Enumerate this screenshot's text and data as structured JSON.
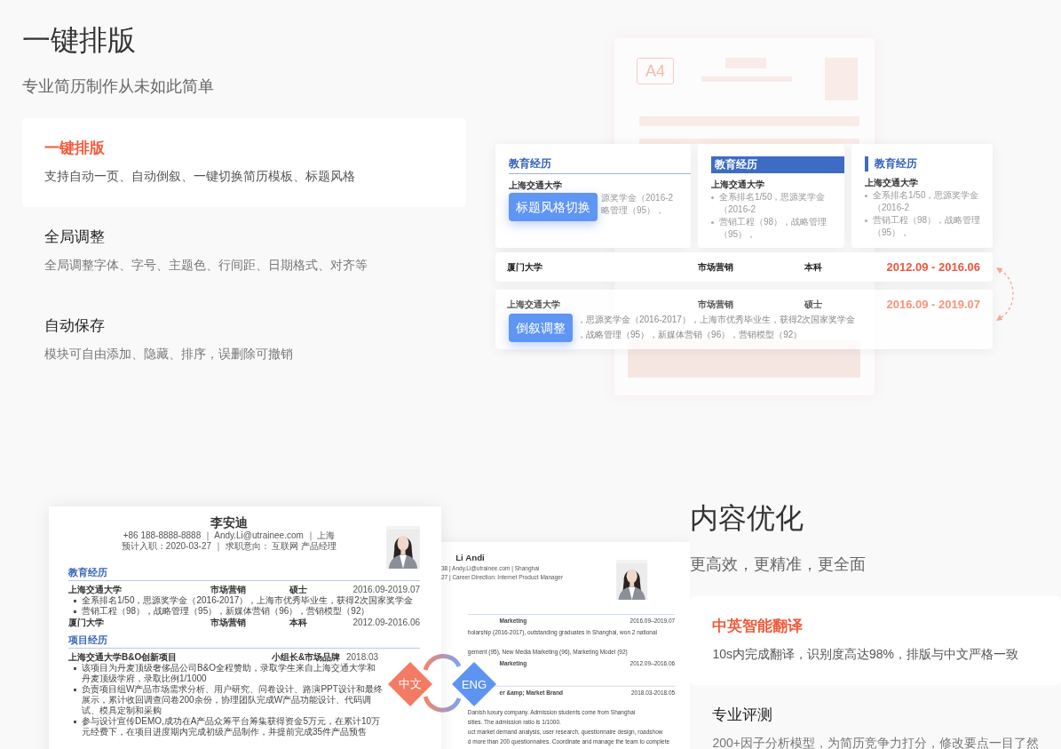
{
  "layout_section": {
    "title": "一键排版",
    "subtitle": "专业简历制作从未如此简单",
    "features": [
      {
        "title": "一键排版",
        "description": "支持自动一页、自动倒叙、一键切换简历模板、标题风格",
        "selected": true
      },
      {
        "title": "全局调整",
        "description": "全局调整字体、字号、主题色、行间距、日期格式、对齐等",
        "selected": false
      },
      {
        "title": "自动保存",
        "description": "模块可自由添加、隐藏、排序，误删除可撤销",
        "selected": false
      }
    ]
  },
  "layout_illustration": {
    "paper_label": "A4",
    "heading_styles": [
      {
        "kind": "underline",
        "heading": "教育经历",
        "school": "上海交通大学",
        "bullets": [
          "源奖学金（2016-2",
          "略管理（95），"
        ]
      },
      {
        "kind": "filled",
        "heading": "教育经历",
        "school": "上海交通大学",
        "bullets": [
          "全系排名1/50，思源奖学金（2016-2",
          "营销工程（98），战略管理（95），"
        ]
      },
      {
        "kind": "bar",
        "heading": "教育经历",
        "school": "上海交通大学",
        "bullets": [
          "全系排名1/50，思源奖学金（2016-2",
          "营销工程（98），战略管理（95），"
        ]
      }
    ],
    "style_badge": "标题风格切换",
    "education_rows": [
      {
        "school": "厦门大学",
        "major": "市场营销",
        "degree": "本科",
        "dates": "2012.09 - 2016.06",
        "selected": true
      },
      {
        "school": "上海交通大学",
        "major": "市场营销",
        "degree": "硕士",
        "dates": "2016.09 - 2019.07",
        "selected": false,
        "bullets": [
          "，思源奖学金（2016-2017），上海市优秀毕业生，获得2次国家奖学金",
          "，战略管理（95），新媒体营销（96），营销模型（92）"
        ]
      }
    ],
    "order_badge": "倒叙调整"
  },
  "resume_cn": {
    "name": "李安迪",
    "contact_lines": [
      "+86 188-8888-8888 ｜ Andy.Li@utrainee.com ｜ 上海",
      "预计入职：2020-03-27 ｜ 求职意向： 互联网 产品经理"
    ],
    "sections": [
      {
        "heading": "教育经历",
        "entries": [
          {
            "kind": "row",
            "cells": [
              "上海交通大学",
              "市场营销",
              "硕士",
              "2016.09-2019.07"
            ]
          },
          {
            "kind": "bullet",
            "text": "全系排名1/50，思源奖学金（2016-2017），上海市优秀毕业生，获得2次国家奖学金"
          },
          {
            "kind": "bullet",
            "text": "营销工程（98），战略管理（95），新媒体营销（96），营销模型（92）"
          },
          {
            "kind": "row",
            "cells": [
              "厦门大学",
              "市场营销",
              "本科",
              "2012.09-2016.06"
            ]
          }
        ]
      },
      {
        "heading": "项目经历",
        "entries": [
          {
            "kind": "row",
            "cells": [
              "上海交通大学B&O创新项目",
              "小组长&市场品牌",
              "2018.03"
            ]
          },
          {
            "kind": "bullet",
            "text": "该项目为丹麦顶级奢侈品公司B&O全程赞助，录取学生来自上海交通大学和丹麦顶级学府，录取比例1/1000"
          },
          {
            "kind": "bullet",
            "text": "负责项目组W产品市场需求分析、用户研究、问卷设计、路演PPT设计和最终展示，累计收回调查问卷200余份，协理团队完成W产品功能设计、代码调试、模具定制和采购"
          },
          {
            "kind": "bullet",
            "text": "参与设计宣传DEMO,成功在A产品众筹平台筹集获得资金5万元，在累计10万元经费下，在项目进度期内完成初级产品制作，并提前完成35件产品预售"
          }
        ]
      }
    ]
  },
  "resume_en": {
    "name": "Li Andi",
    "contact_lines": [
      "38 | Andy.Li@utrainee.com | Shanghai",
      "27 | Career Direction: Internet Product Manager"
    ],
    "sections": [
      {
        "entries": [
          {
            "kind": "row",
            "cells": [
              "Marketing",
              "2016.09–2019.07"
            ]
          },
          {
            "kind": "line",
            "text": "holarship (2016-2017), outstanding graduates in Shanghai, won 2 national"
          },
          {
            "kind": "line",
            "text": "gement (95), New Media Marketing (96), Marketing Model (92)"
          },
          {
            "kind": "row",
            "cells": [
              "Marketing",
              "2012.09–2016.06"
            ]
          }
        ]
      },
      {
        "entries": [
          {
            "kind": "row",
            "cells": [
              "er &amp; Market Brand",
              "2018.03-2018.05"
            ]
          },
          {
            "kind": "line",
            "text": "Danish luxury company. Admission students come from Shanghai"
          },
          {
            "kind": "line",
            "text": "sities. The admission ratio is 1/1000."
          },
          {
            "kind": "line",
            "text": "uct market demand analysis, user research, questionnaire design, roadshow"
          },
          {
            "kind": "line",
            "text": "d more than 200 questionnaires. Coordinate and manage the team to complete"
          }
        ]
      }
    ]
  },
  "translate_badges": [
    {
      "kind": "source",
      "label": "中文"
    },
    {
      "kind": "target",
      "label": "ENG"
    }
  ],
  "content_section": {
    "title": "内容优化",
    "subtitle": "更高效，更精准，更全面",
    "features": [
      {
        "title": "中英智能翻译",
        "description": "10s内完成翻译，识别度高达98%，排版与中文严格一致",
        "selected": true
      },
      {
        "title": "专业评测",
        "description": "200+因子分析模型，为简历竞争力打分，修改要点一目了然",
        "selected": false
      }
    ]
  }
}
